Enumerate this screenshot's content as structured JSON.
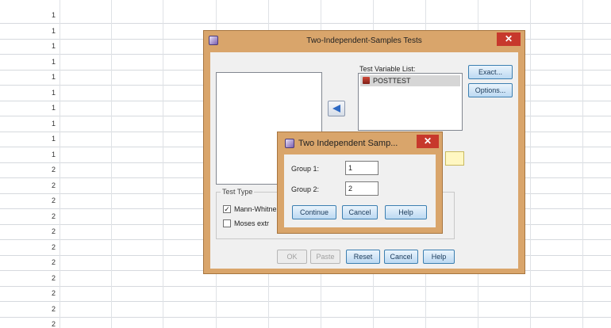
{
  "background": {
    "row_numbers": [
      "1",
      "1",
      "1",
      "1",
      "1",
      "1",
      "1",
      "1",
      "1",
      "1",
      "2",
      "2",
      "2",
      "2",
      "2",
      "2",
      "2",
      "2",
      "2",
      "2",
      "2"
    ]
  },
  "main_dialog": {
    "title": "Two-Independent-Samples Tests",
    "close_glyph": "✕",
    "test_variable_label": "Test Variable List:",
    "test_variables": [
      "POSTTEST"
    ],
    "buttons": {
      "exact": "Exact...",
      "options": "Options...",
      "ok": "OK",
      "paste": "Paste",
      "reset": "Reset",
      "cancel": "Cancel",
      "help": "Help"
    },
    "test_type": {
      "label": "Test Type",
      "mann_whitney": {
        "label": "Mann-Whitne",
        "checked": true
      },
      "moses": {
        "label": "Moses extr",
        "checked": false
      }
    }
  },
  "sub_dialog": {
    "title": "Two Independent Samp...",
    "close_glyph": "✕",
    "group1_label": "Group 1:",
    "group1_value": "1",
    "group2_label": "Group 2:",
    "group2_value": "2",
    "buttons": {
      "continue": "Continue",
      "cancel": "Cancel",
      "help": "Help"
    }
  },
  "colors": {
    "dialog_frame": "#d9a56b",
    "close_button": "#c7382c",
    "client_bg": "#f0f0f0"
  }
}
